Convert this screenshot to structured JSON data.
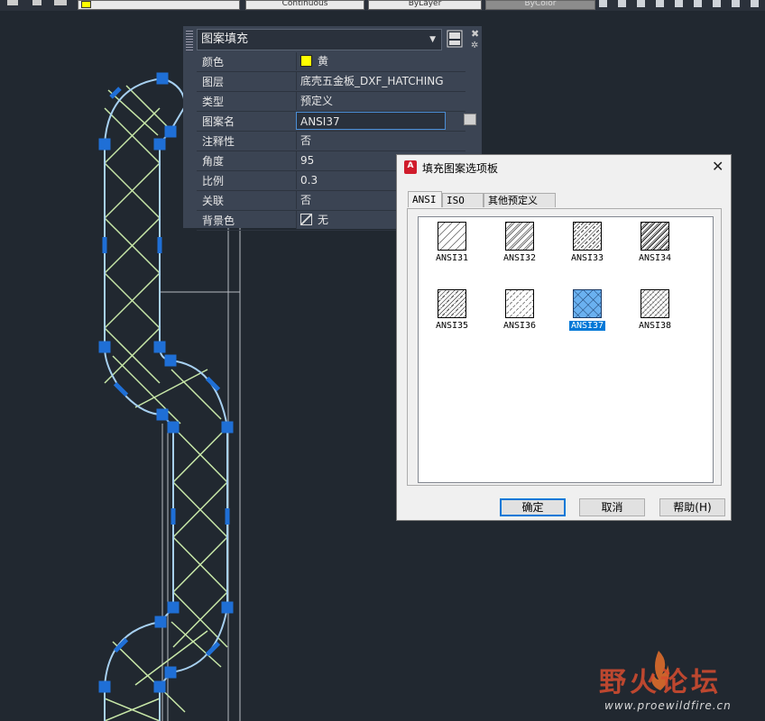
{
  "topbar": {
    "linetype_value": "Continuous",
    "lineweight_value": "ByLayer",
    "plotstyle_value": "ByColor"
  },
  "properties": {
    "object_type": "图案填充",
    "rows": [
      {
        "key": "颜色",
        "value": "黄",
        "swatch": "#ffff00"
      },
      {
        "key": "图层",
        "value": "底壳五金板_DXF_HATCHING"
      },
      {
        "key": "类型",
        "value": "预定义"
      },
      {
        "key": "图案名",
        "value": "ANSI37"
      },
      {
        "key": "注释性",
        "value": "否"
      },
      {
        "key": "角度",
        "value": "95"
      },
      {
        "key": "比例",
        "value": "0.3"
      },
      {
        "key": "关联",
        "value": "否"
      },
      {
        "key": "背景色",
        "value": "无"
      }
    ]
  },
  "dialog": {
    "title": "填充图案选项板",
    "app_icon_text": "A",
    "tabs": [
      {
        "label": "ANSI",
        "active": true
      },
      {
        "label": "ISO",
        "active": false
      },
      {
        "label": "其他预定义",
        "active": false
      }
    ],
    "patterns": [
      {
        "name": "ANSI31",
        "selected": false
      },
      {
        "name": "ANSI32",
        "selected": false
      },
      {
        "name": "ANSI33",
        "selected": false
      },
      {
        "name": "ANSI34",
        "selected": false
      },
      {
        "name": "ANSI35",
        "selected": false
      },
      {
        "name": "ANSI36",
        "selected": false
      },
      {
        "name": "ANSI37",
        "selected": true
      },
      {
        "name": "ANSI38",
        "selected": false
      }
    ],
    "buttons": {
      "ok": "确定",
      "cancel": "取消",
      "help": "帮助(H)"
    }
  },
  "watermark": {
    "brand": "野火论坛",
    "url": "www.proewildfire.cn"
  },
  "colors": {
    "canvas": "#212830",
    "hatch": "#c8e8a8",
    "grip": "#1f6fd6",
    "selection": "#0078d7"
  }
}
